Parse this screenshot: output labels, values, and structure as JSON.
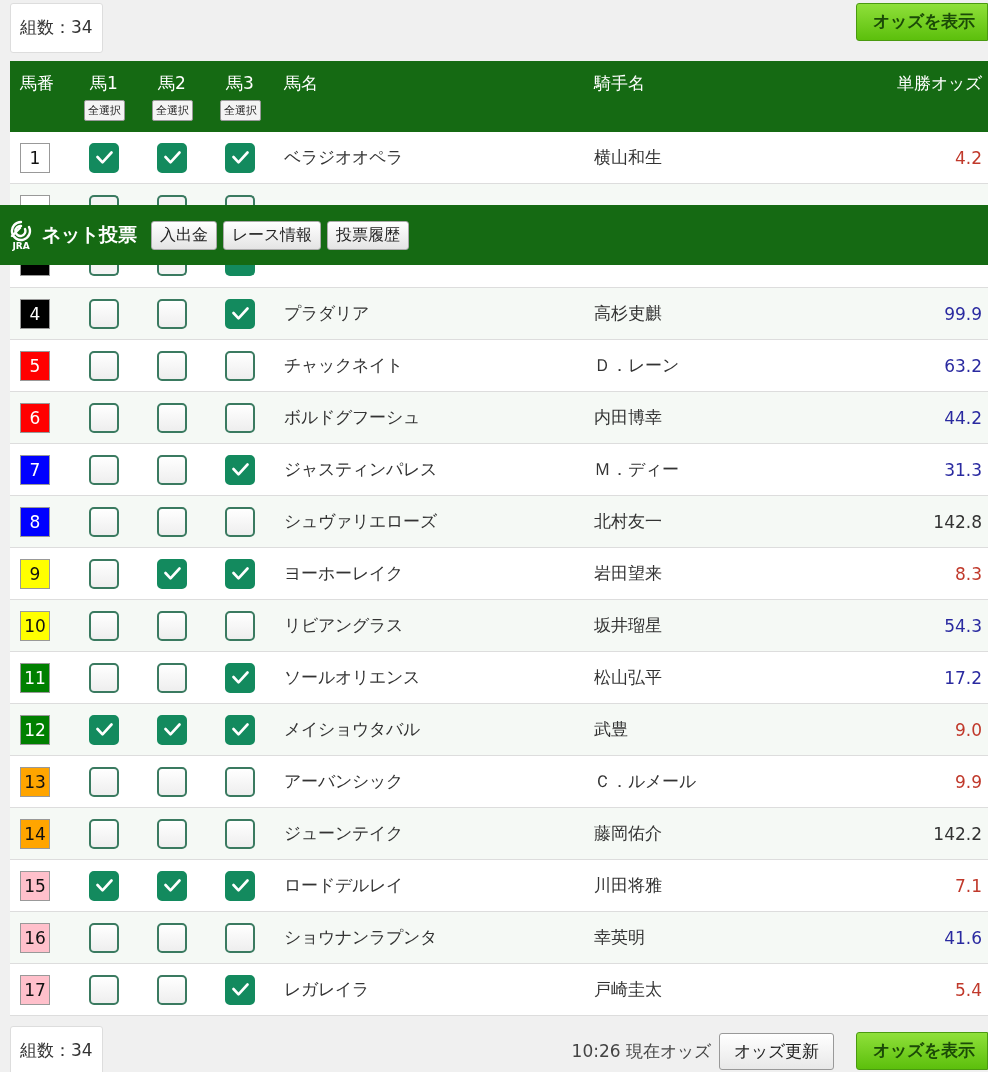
{
  "top": {
    "count_label": "組数：34",
    "show_odds_button": "オッズを表示"
  },
  "table": {
    "columns": {
      "number": "馬番",
      "pick_1": "馬1",
      "pick_2": "馬2",
      "pick_3": "馬3",
      "select_all": [
        "全選択",
        "全選択",
        "全選択"
      ],
      "name": "馬名",
      "jockey": "騎手名",
      "odds": "単勝オッズ"
    },
    "rows": [
      {
        "number": {
          "text": "1",
          "color": "#ffffff"
        },
        "picks": [
          {
            "checked": true
          },
          {
            "checked": true
          },
          {
            "checked": true
          }
        ],
        "name": "ベラジオオペラ",
        "jockey": "横山和生",
        "odds": {
          "text": "4.2",
          "color": "#c0392b"
        }
      },
      {
        "kind": "cut_top",
        "number": {
          "color": "#ffffff"
        },
        "picks": [
          {
            "checked": false
          },
          {
            "checked": false
          },
          {
            "checked": false
          }
        ]
      },
      {
        "kind": "cut_bottom",
        "number": {
          "color": "#000000"
        },
        "picks": [
          {
            "checked": false
          },
          {
            "checked": false
          },
          {
            "checked": true
          }
        ]
      },
      {
        "number": {
          "text": "4",
          "color": "#000000"
        },
        "picks": [
          {
            "checked": false
          },
          {
            "checked": false
          },
          {
            "checked": true
          }
        ],
        "name": "プラダリア",
        "jockey": "高杉吏麒",
        "odds": {
          "text": "99.9",
          "color": "#2a2aa0"
        }
      },
      {
        "number": {
          "text": "5",
          "color": "#ff0000"
        },
        "picks": [
          {
            "checked": false
          },
          {
            "checked": false
          },
          {
            "checked": false
          }
        ],
        "name": "チャックネイト",
        "jockey": "Ｄ．レーン",
        "odds": {
          "text": "63.2",
          "color": "#2a2aa0"
        }
      },
      {
        "number": {
          "text": "6",
          "color": "#ff0000"
        },
        "picks": [
          {
            "checked": false
          },
          {
            "checked": false
          },
          {
            "checked": false
          }
        ],
        "name": "ボルドグフーシュ",
        "jockey": "内田博幸",
        "odds": {
          "text": "44.2",
          "color": "#2a2aa0"
        }
      },
      {
        "number": {
          "text": "7",
          "color": "#0000ff"
        },
        "picks": [
          {
            "checked": false
          },
          {
            "checked": false
          },
          {
            "checked": true
          }
        ],
        "name": "ジャスティンパレス",
        "jockey": "Ｍ．ディー",
        "odds": {
          "text": "31.3",
          "color": "#2a2aa0"
        }
      },
      {
        "number": {
          "text": "8",
          "color": "#0000ff"
        },
        "picks": [
          {
            "checked": false
          },
          {
            "checked": false
          },
          {
            "checked": false
          }
        ],
        "name": "シュヴァリエローズ",
        "jockey": "北村友一",
        "odds": {
          "text": "142.8",
          "color": "#333333"
        }
      },
      {
        "number": {
          "text": "9",
          "color": "#ffff00"
        },
        "picks": [
          {
            "checked": false
          },
          {
            "checked": true
          },
          {
            "checked": true
          }
        ],
        "name": "ヨーホーレイク",
        "jockey": "岩田望来",
        "odds": {
          "text": "8.3",
          "color": "#c0392b"
        }
      },
      {
        "number": {
          "text": "10",
          "color": "#ffff00"
        },
        "picks": [
          {
            "checked": false
          },
          {
            "checked": false
          },
          {
            "checked": false
          }
        ],
        "name": "リビアングラス",
        "jockey": "坂井瑠星",
        "odds": {
          "text": "54.3",
          "color": "#2a2aa0"
        }
      },
      {
        "number": {
          "text": "11",
          "color": "#008000"
        },
        "picks": [
          {
            "checked": false
          },
          {
            "checked": false
          },
          {
            "checked": true
          }
        ],
        "name": "ソールオリエンス",
        "jockey": "松山弘平",
        "odds": {
          "text": "17.2",
          "color": "#2a2aa0"
        }
      },
      {
        "number": {
          "text": "12",
          "color": "#008000"
        },
        "picks": [
          {
            "checked": true
          },
          {
            "checked": true
          },
          {
            "checked": true
          }
        ],
        "name": "メイショウタバル",
        "jockey": "武豊",
        "odds": {
          "text": "9.0",
          "color": "#c0392b"
        }
      },
      {
        "number": {
          "text": "13",
          "color": "#ffa500"
        },
        "picks": [
          {
            "checked": false
          },
          {
            "checked": false
          },
          {
            "checked": false
          }
        ],
        "name": "アーバンシック",
        "jockey": "Ｃ．ルメール",
        "odds": {
          "text": "9.9",
          "color": "#c0392b"
        }
      },
      {
        "number": {
          "text": "14",
          "color": "#ffa500"
        },
        "picks": [
          {
            "checked": false
          },
          {
            "checked": false
          },
          {
            "checked": false
          }
        ],
        "name": "ジューンテイク",
        "jockey": "藤岡佑介",
        "odds": {
          "text": "142.2",
          "color": "#333333"
        }
      },
      {
        "number": {
          "text": "15",
          "color": "#ffc0cb"
        },
        "picks": [
          {
            "checked": true
          },
          {
            "checked": true
          },
          {
            "checked": true
          }
        ],
        "name": "ロードデルレイ",
        "jockey": "川田将雅",
        "odds": {
          "text": "7.1",
          "color": "#c0392b"
        }
      },
      {
        "number": {
          "text": "16",
          "color": "#ffc0cb"
        },
        "picks": [
          {
            "checked": false
          },
          {
            "checked": false
          },
          {
            "checked": false
          }
        ],
        "name": "ショウナンラプンタ",
        "jockey": "幸英明",
        "odds": {
          "text": "41.6",
          "color": "#2a2aa0"
        }
      },
      {
        "number": {
          "text": "17",
          "color": "#ffc0cb"
        },
        "picks": [
          {
            "checked": false
          },
          {
            "checked": false
          },
          {
            "checked": true
          }
        ],
        "name": "レガレイラ",
        "jockey": "戸崎圭太",
        "odds": {
          "text": "5.4",
          "color": "#c0392b"
        }
      }
    ]
  },
  "overlay_bar": {
    "logo_text": "JRA",
    "title": "ネット投票",
    "buttons": [
      "入出金",
      "レース情報",
      "投票履歴"
    ]
  },
  "bottom": {
    "count_label": "組数：34",
    "odds_time": "10:26 現在オッズ",
    "refresh_button": "オッズ更新",
    "show_odds_button": "オッズを表示"
  }
}
